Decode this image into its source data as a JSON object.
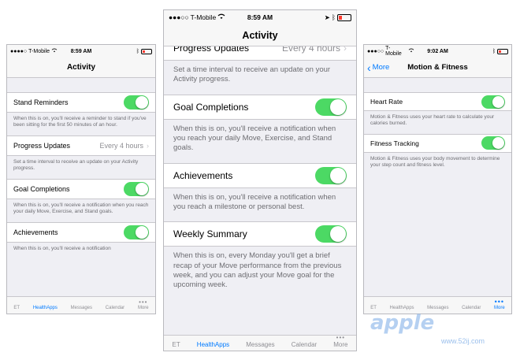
{
  "phones": [
    {
      "status": {
        "carrier": "T-Mobile",
        "time": "8:59 AM"
      },
      "nav": {
        "title": "Activity"
      },
      "rows": [
        {
          "label": "Stand Reminders",
          "footer": "When this is on, you'll receive a reminder to stand if you've been sitting for the first 50 minutes of an hour."
        },
        {
          "label": "Progress Updates",
          "value": "Every 4 hours",
          "footer": "Set a time interval to receive an update on your Activity progress."
        },
        {
          "label": "Goal Completions",
          "footer": "When this is on, you'll receive a notification when you reach your daily Move, Exercise, and Stand goals."
        },
        {
          "label": "Achievements",
          "footer": "When this is on, you'll receive a notification"
        }
      ],
      "tabs": [
        "ET",
        "HealthApps",
        "Messages",
        "Calendar",
        "More"
      ],
      "more_dots": "•••"
    },
    {
      "status": {
        "carrier": "T-Mobile",
        "time": "8:59 AM"
      },
      "nav": {
        "title": "Activity"
      },
      "rows": [
        {
          "label": "Progress Updates",
          "value": "Every 4 hours",
          "footer": "Set a time interval to receive an update on your Activity progress."
        },
        {
          "label": "Goal Completions",
          "footer": "When this is on, you'll receive a notification when you reach your daily Move, Exercise, and Stand goals."
        },
        {
          "label": "Achievements",
          "footer": "When this is on, you'll receive a notification when you reach a milestone or personal best."
        },
        {
          "label": "Weekly Summary",
          "footer": "When this is on, every Monday you'll get a brief recap of your Move performance from the previous week, and you can adjust your Move goal for the upcoming week."
        }
      ],
      "tabs": [
        "ET",
        "HealthApps",
        "Messages",
        "Calendar",
        "More"
      ],
      "more_dots": "•••"
    },
    {
      "status": {
        "carrier": "T-Mobile",
        "time": "9:02 AM"
      },
      "nav": {
        "title": "Motion & Fitness",
        "back": "More"
      },
      "rows": [
        {
          "label": "Heart Rate",
          "footer": "Motion & Fitness uses your heart rate to calculate your calories burned."
        },
        {
          "label": "Fitness Tracking",
          "footer": "Motion & Fitness uses your body movement to determine your step count and fitness level."
        }
      ],
      "tabs": [
        "ET",
        "HealthApps",
        "Messages",
        "Calendar",
        "More"
      ],
      "more_dots": "•••"
    }
  ],
  "watermark": {
    "text": "apple",
    "sub": "www.52ij.com"
  },
  "colors": {
    "accent": "#007aff",
    "switch_on": "#4cd964",
    "battery": "#ff3b30",
    "background": "#efeff4"
  },
  "icons": [
    "signal-dots-icon",
    "wifi-icon",
    "location-arrow-icon",
    "bluetooth-icon",
    "battery-icon",
    "chevron-right-icon",
    "switch-toggle",
    "back-chevron-icon"
  ]
}
